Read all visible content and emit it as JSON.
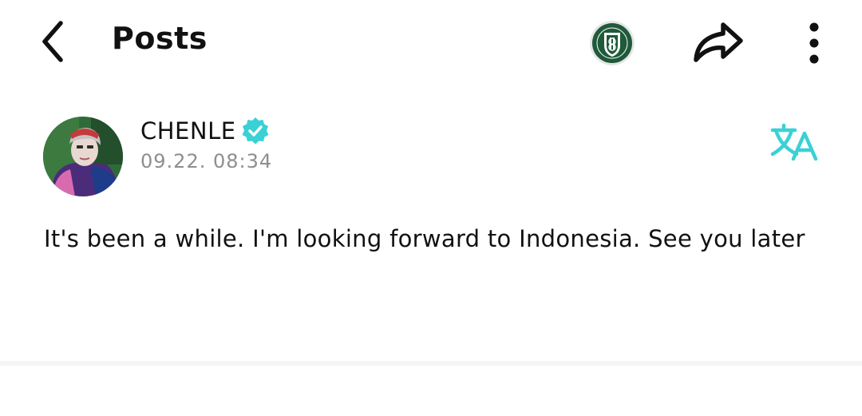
{
  "header": {
    "title": "Posts",
    "back_icon": "chevron-left-icon",
    "community_badge_icon": "community-crest-icon",
    "share_icon": "share-arrow-icon",
    "more_icon": "more-vertical-icon"
  },
  "post": {
    "author": "CHENLE",
    "verified_icon": "verified-badge-icon",
    "timestamp": "09.22. 08:34",
    "translate_icon": "translate-icon",
    "body": "It's been a while. I'm looking forward to Indonesia. See you later"
  },
  "colors": {
    "accent": "#3ad1d6",
    "text": "#111111",
    "muted": "#8e8e8e",
    "badge_green": "#1f5a3a"
  }
}
